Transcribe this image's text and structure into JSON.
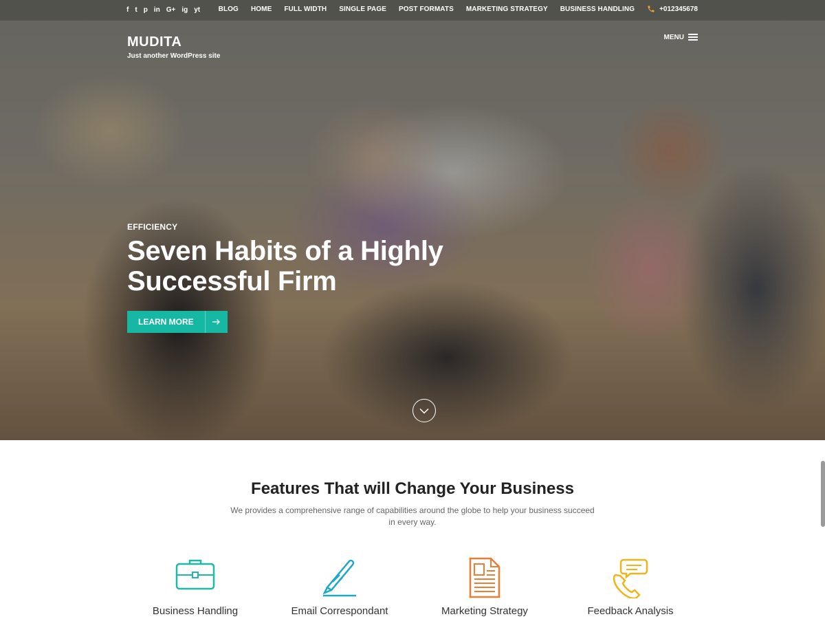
{
  "topbar": {
    "social": [
      "f",
      "t",
      "p",
      "in",
      "G+",
      "ig",
      "yt"
    ],
    "nav": [
      "BLOG",
      "HOME",
      "FULL WIDTH",
      "SINGLE PAGE",
      "POST FORMATS",
      "MARKETING STRATEGY",
      "BUSINESS HANDLING"
    ],
    "phone": "+012345678"
  },
  "brand": {
    "title": "MUDITA",
    "tagline": "Just another WordPress site"
  },
  "menu": {
    "label": "MENU"
  },
  "hero": {
    "tag": "EFFICIENCY",
    "title": "Seven Habits of a Highly Successful Firm",
    "button": "LEARN MORE"
  },
  "features": {
    "title": "Features That will Change Your Business",
    "subtitle": "We provides a comprehensive range of capabilities around the globe to help your business succeed in every way.",
    "items": [
      {
        "label": "Business Handling",
        "icon": "briefcase-icon",
        "color": "#1cb9a6"
      },
      {
        "label": "Email Correspondant",
        "icon": "pen-icon",
        "color": "#1aa9c9"
      },
      {
        "label": "Marketing Strategy",
        "icon": "document-icon",
        "color": "#ee7d33"
      },
      {
        "label": "Feedback Analysis",
        "icon": "phone-chat-icon",
        "color": "#f2b316"
      }
    ]
  },
  "colors": {
    "accent": "#16b8a4",
    "phone_icon": "#f2a23a"
  }
}
